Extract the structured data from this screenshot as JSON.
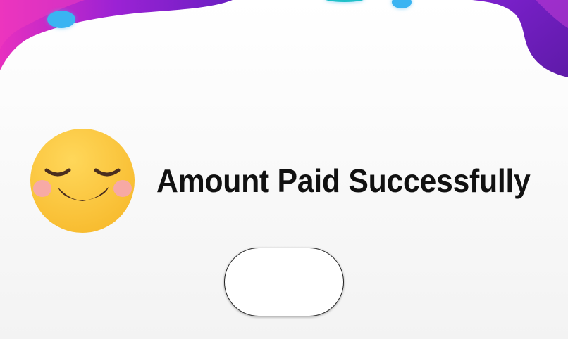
{
  "message": {
    "text": "Amount Paid Successfully"
  },
  "action_button": {
    "label": ""
  },
  "icons": {
    "status": "smiling-face-icon"
  },
  "colors": {
    "wave_primary": "#8a1bd0",
    "wave_secondary": "#6a1fc2",
    "wave_accent": "#d12fc9",
    "bubble": "#3ab4f2",
    "emoji_face": "#fcc63c",
    "emoji_cheek": "#f6a6b0",
    "emoji_features": "#4a2e1e",
    "text": "#111111",
    "background": "#f4f4f4"
  }
}
